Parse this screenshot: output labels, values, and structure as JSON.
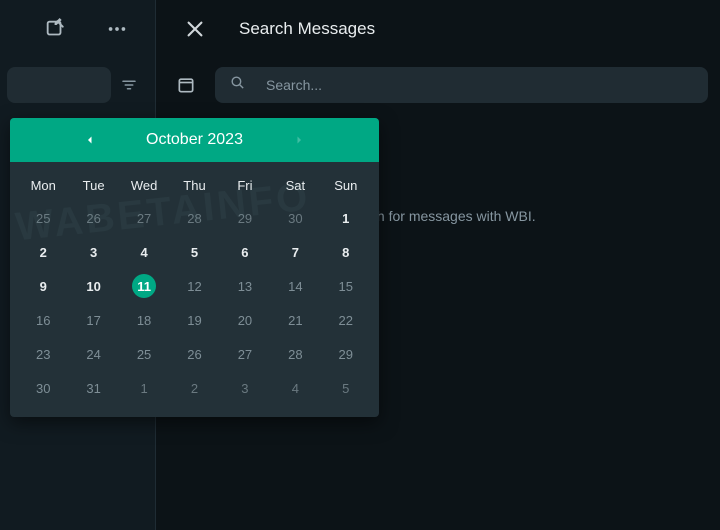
{
  "header": {
    "title": "Search Messages"
  },
  "search": {
    "placeholder": "Search..."
  },
  "hint": "Search for messages with WBI.",
  "calendar": {
    "month_label": "October 2023",
    "dow": [
      "Mon",
      "Tue",
      "Wed",
      "Thu",
      "Fri",
      "Sat",
      "Sun"
    ],
    "weeks": [
      [
        {
          "d": "25",
          "state": "out"
        },
        {
          "d": "26",
          "state": "out"
        },
        {
          "d": "27",
          "state": "out"
        },
        {
          "d": "28",
          "state": "out"
        },
        {
          "d": "29",
          "state": "out"
        },
        {
          "d": "30",
          "state": "out"
        },
        {
          "d": "1",
          "state": "bold"
        }
      ],
      [
        {
          "d": "2",
          "state": "bold"
        },
        {
          "d": "3",
          "state": "bold"
        },
        {
          "d": "4",
          "state": "bold"
        },
        {
          "d": "5",
          "state": "bold"
        },
        {
          "d": "6",
          "state": "bold"
        },
        {
          "d": "7",
          "state": "bold"
        },
        {
          "d": "8",
          "state": "bold"
        }
      ],
      [
        {
          "d": "9",
          "state": "bold"
        },
        {
          "d": "10",
          "state": "bold"
        },
        {
          "d": "11",
          "state": "today"
        },
        {
          "d": "12",
          "state": "dim"
        },
        {
          "d": "13",
          "state": "dim"
        },
        {
          "d": "14",
          "state": "dim"
        },
        {
          "d": "15",
          "state": "dim"
        }
      ],
      [
        {
          "d": "16",
          "state": "dim"
        },
        {
          "d": "17",
          "state": "dim"
        },
        {
          "d": "18",
          "state": "dim"
        },
        {
          "d": "19",
          "state": "dim"
        },
        {
          "d": "20",
          "state": "dim"
        },
        {
          "d": "21",
          "state": "dim"
        },
        {
          "d": "22",
          "state": "dim"
        }
      ],
      [
        {
          "d": "23",
          "state": "dim"
        },
        {
          "d": "24",
          "state": "dim"
        },
        {
          "d": "25",
          "state": "dim"
        },
        {
          "d": "26",
          "state": "dim"
        },
        {
          "d": "27",
          "state": "dim"
        },
        {
          "d": "28",
          "state": "dim"
        },
        {
          "d": "29",
          "state": "dim"
        }
      ],
      [
        {
          "d": "30",
          "state": "dim"
        },
        {
          "d": "31",
          "state": "dim"
        },
        {
          "d": "1",
          "state": "out"
        },
        {
          "d": "2",
          "state": "out"
        },
        {
          "d": "3",
          "state": "out"
        },
        {
          "d": "4",
          "state": "out"
        },
        {
          "d": "5",
          "state": "out"
        }
      ]
    ]
  },
  "watermark": "WABETAINFO",
  "colors": {
    "accent": "#00a884",
    "bg": "#0c1317",
    "panel": "#111b21",
    "input": "#202c33",
    "popover": "#233138"
  }
}
